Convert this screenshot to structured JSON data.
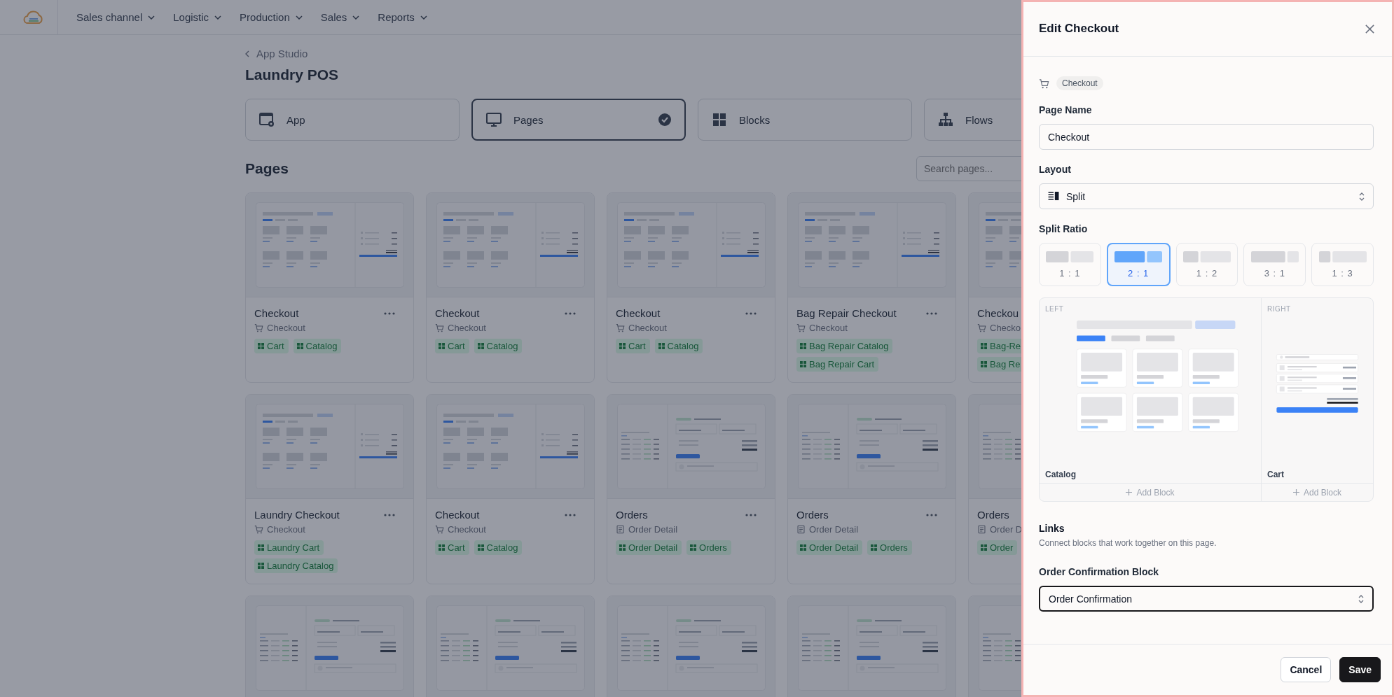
{
  "nav": {
    "items": [
      {
        "label": "Sales channel"
      },
      {
        "label": "Logistic"
      },
      {
        "label": "Production"
      },
      {
        "label": "Sales"
      },
      {
        "label": "Reports"
      }
    ]
  },
  "breadcrumb": {
    "label": "App Studio"
  },
  "title": "Laundry POS",
  "sections": [
    {
      "label": "App",
      "kind": "app",
      "selected": false
    },
    {
      "label": "Pages",
      "kind": "pages",
      "selected": true
    },
    {
      "label": "Blocks",
      "kind": "blocks",
      "selected": false
    },
    {
      "label": "Flows",
      "kind": "flows",
      "selected": false
    }
  ],
  "pages_heading": "Pages",
  "search": {
    "placeholder": "Search pages..."
  },
  "cards": [
    {
      "kind": "grid",
      "title": "Checkout",
      "type": "Checkout",
      "tags": [
        "Cart",
        "Catalog"
      ]
    },
    {
      "kind": "grid",
      "title": "Checkout",
      "type": "Checkout",
      "tags": [
        "Cart",
        "Catalog"
      ]
    },
    {
      "kind": "grid",
      "title": "Checkout",
      "type": "Checkout",
      "tags": [
        "Cart",
        "Catalog"
      ]
    },
    {
      "kind": "grid",
      "title": "Bag Repair Checkout",
      "type": "Checkout",
      "tags": [
        "Bag Repair Catalog",
        "Bag Repair Cart"
      ]
    },
    {
      "kind": "grid",
      "title": "Checkou",
      "type": "Checko",
      "tags": [
        "Bag-Re",
        "Bag Re"
      ]
    },
    {
      "kind": "grid",
      "title": "Laundry Checkout",
      "type": "Checkout",
      "tags": [
        "Laundry Cart",
        "Laundry Catalog"
      ]
    },
    {
      "kind": "grid",
      "title": "Checkout",
      "type": "Checkout",
      "tags": [
        "Cart",
        "Catalog"
      ]
    },
    {
      "kind": "detail",
      "title": "Orders",
      "type": "Order Detail",
      "tags": [
        "Order Detail",
        "Orders"
      ]
    },
    {
      "kind": "detail",
      "title": "Orders",
      "type": "Order Detail",
      "tags": [
        "Order Detail",
        "Orders"
      ]
    },
    {
      "kind": "detail",
      "title": "Orders",
      "type": "Order D",
      "tags": [
        "Order"
      ]
    },
    {
      "kind": "detail"
    },
    {
      "kind": "detail"
    },
    {
      "kind": "detail"
    },
    {
      "kind": "detail"
    },
    {
      "kind": "detail"
    }
  ],
  "drawer": {
    "title": "Edit Checkout",
    "type_chip": "Checkout",
    "page_name": {
      "label": "Page Name",
      "value": "Checkout"
    },
    "layout": {
      "label": "Layout",
      "value": "Split"
    },
    "split_ratio": {
      "label": "Split Ratio",
      "options": [
        {
          "label": "1 : 1",
          "kind": "even",
          "selected": false
        },
        {
          "label": "2 : 1",
          "kind": "left-wide",
          "selected": true
        },
        {
          "label": "1 : 2",
          "kind": "right-wide",
          "selected": false
        },
        {
          "label": "3 : 1",
          "kind": "left-wider",
          "selected": false
        },
        {
          "label": "1 : 3",
          "kind": "right-wider",
          "selected": false
        }
      ]
    },
    "preview": {
      "columns": [
        {
          "label": "LEFT",
          "kind": "catalog",
          "block": "Catalog",
          "add": "Add Block"
        },
        {
          "label": "RIGHT",
          "kind": "cart",
          "block": "Cart",
          "add": "Add Block"
        }
      ]
    },
    "links": {
      "title": "Links",
      "description": "Connect blocks that work together on this page."
    },
    "order_confirmation": {
      "label": "Order Confirmation Block",
      "value": "Order Confirmation",
      "focused": true
    },
    "buttons": [
      {
        "label": "Cancel",
        "kind": "secondary"
      },
      {
        "label": "Save",
        "kind": "primary"
      }
    ]
  }
}
